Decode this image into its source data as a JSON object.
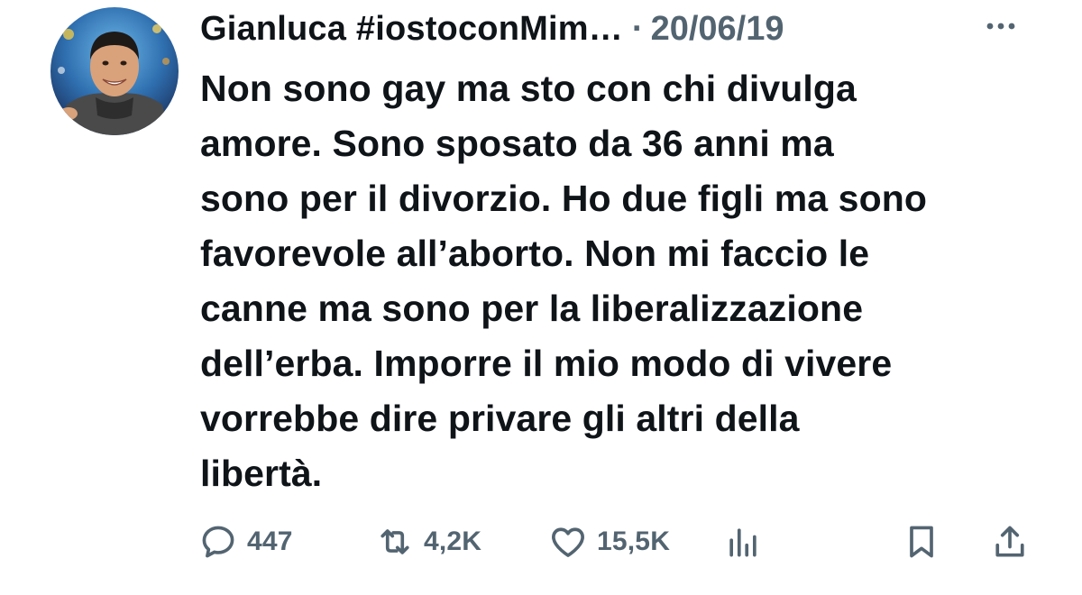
{
  "author": {
    "display_name": "Gianluca #iostoconMim…",
    "date": "20/06/19",
    "separator": "·"
  },
  "tweet": {
    "lines": [
      "Non sono gay ma sto con chi divulga",
      "amore. Sono sposato da 36 anni ma",
      "sono per il divorzio. Ho due figli ma sono",
      "favorevole all’aborto. Non mi faccio le",
      "canne ma sono per la liberalizzazione",
      "dell’erba. Imporre il mio modo di vivere",
      "vorrebbe dire privare gli altri della",
      "libertà."
    ]
  },
  "actions": {
    "reply": {
      "icon": "reply-icon",
      "count": "447"
    },
    "retweet": {
      "icon": "retweet-icon",
      "count": "4,2K"
    },
    "like": {
      "icon": "heart-icon",
      "count": "15,5K"
    },
    "views": {
      "icon": "analytics-icon"
    },
    "bookmark": {
      "icon": "bookmark-icon"
    },
    "share": {
      "icon": "share-icon"
    }
  },
  "colors": {
    "text": "#0f1419",
    "secondary": "#536471",
    "background": "#ffffff"
  }
}
